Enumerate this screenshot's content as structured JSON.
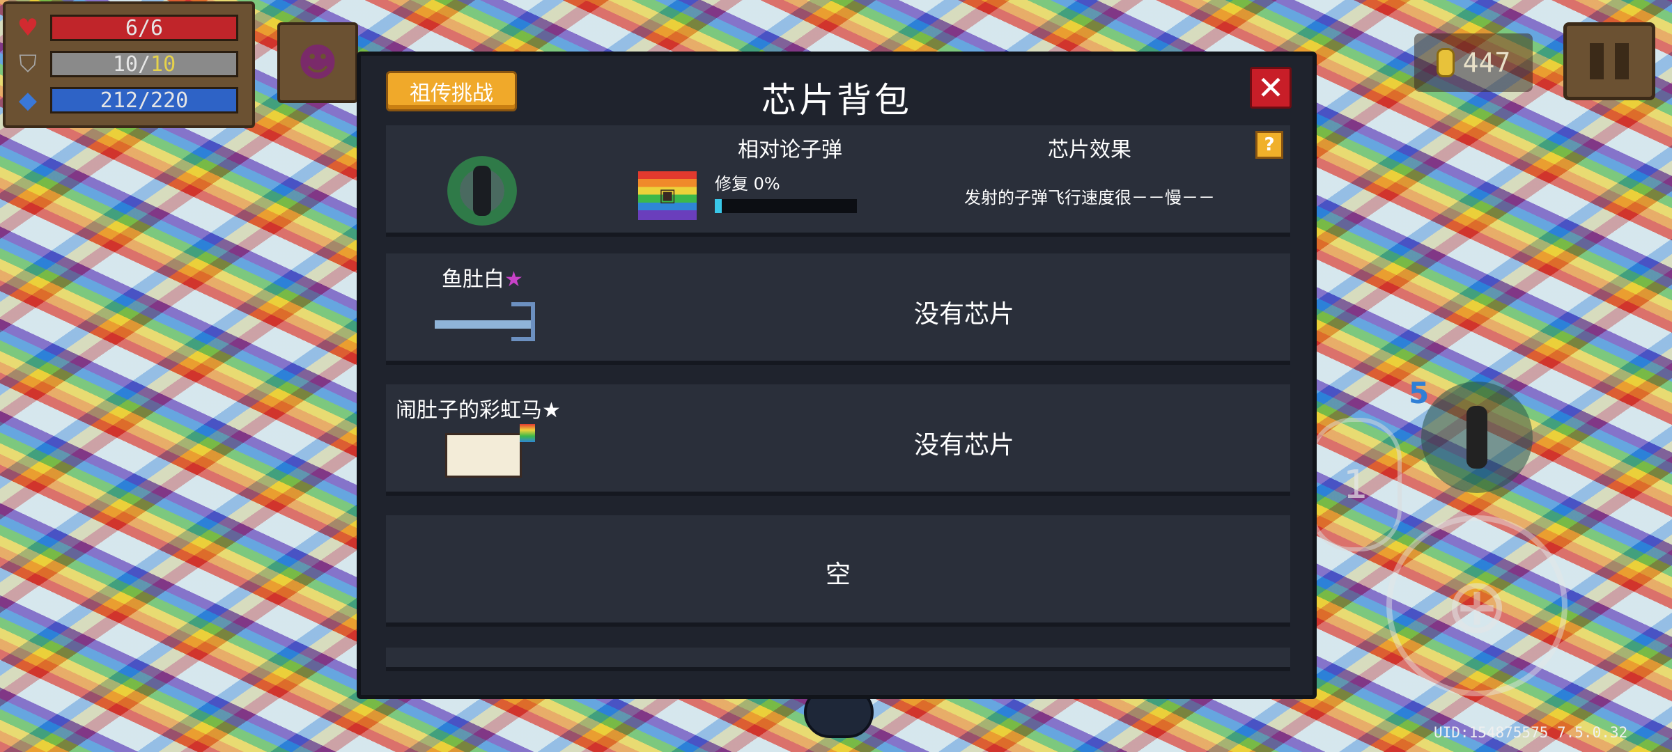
{
  "hud": {
    "hp": "6/6",
    "armor_current": "10/",
    "armor_max": "10",
    "energy": "212/220",
    "coins": "447"
  },
  "panel": {
    "title": "芯片背包",
    "ancestral_button": "祖传挑战",
    "close_label": "✕"
  },
  "chip_slot": {
    "bullet_name": "相对论子弹",
    "repair_label": "修复 0%",
    "repair_progress": 0.05,
    "effect_title": "芯片效果",
    "help_label": "?",
    "effect_text": "发射的子弹飞行速度很－－慢－－"
  },
  "pets": [
    {
      "name": "鱼肚白",
      "star": "★",
      "status": "没有芯片"
    },
    {
      "name": "闹肚子的彩虹马",
      "star": "★",
      "status": "没有芯片"
    }
  ],
  "empty_slot": {
    "label": "空"
  },
  "controls": {
    "weapon_count": "5",
    "skill_label": "1"
  },
  "uid": "UID:154875575 7.5.0.32",
  "colors": {
    "panel_bg": "#1f232d",
    "slot_bg": "#2a2f3a",
    "button_orange": "#f0a92a",
    "close_red": "#c81e28",
    "star_purple": "#c842c8"
  },
  "icons": {
    "hp": "heart-icon",
    "armor": "shield-icon",
    "energy": "diamond-icon",
    "coin": "coin-icon",
    "pause": "pause-icon"
  }
}
